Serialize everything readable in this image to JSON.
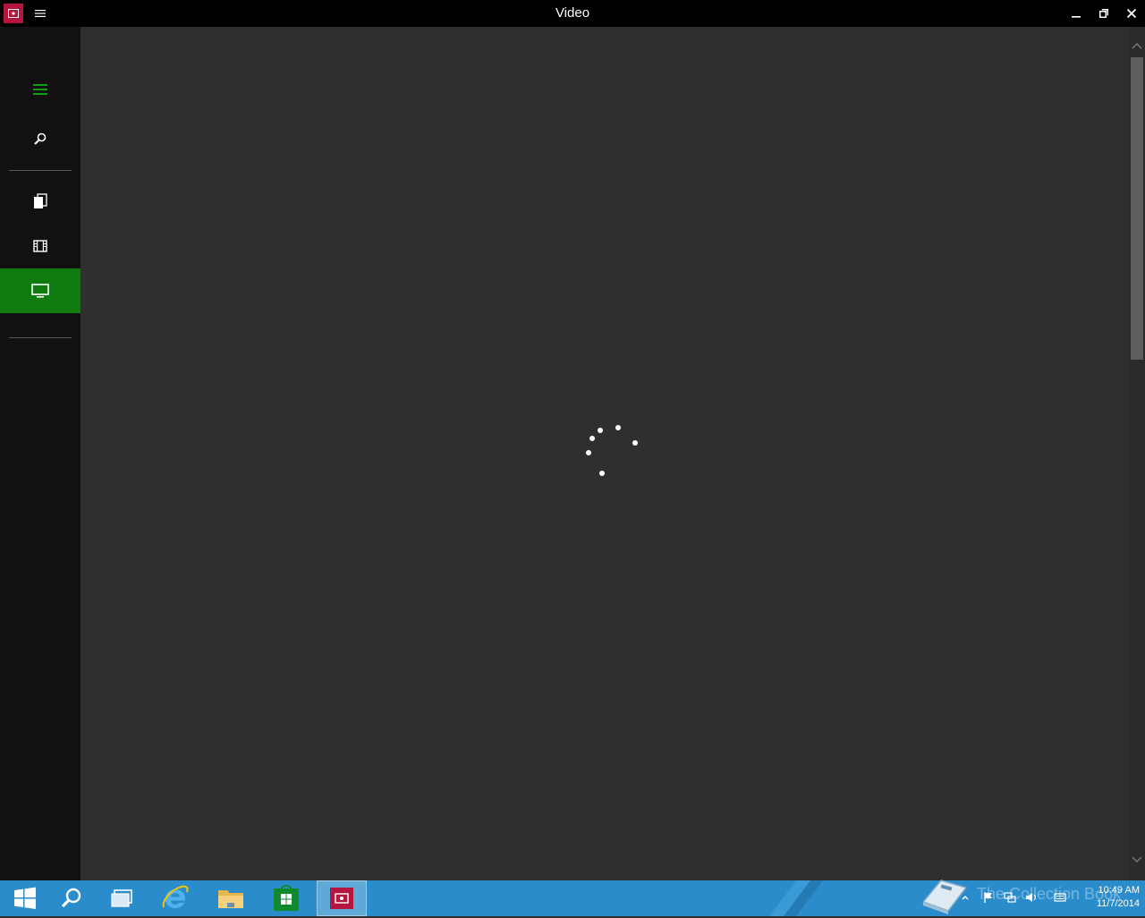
{
  "window": {
    "title": "Video"
  },
  "sidebar": {
    "items": [
      {
        "name": "menu",
        "selected": false
      },
      {
        "name": "search",
        "selected": false
      },
      {
        "name": "collection",
        "selected": false
      },
      {
        "name": "movies",
        "selected": false
      },
      {
        "name": "tv",
        "selected": true
      }
    ]
  },
  "content": {
    "state": "loading"
  },
  "taskbar": {
    "items": [
      "start",
      "search",
      "task-view",
      "internet-explorer",
      "file-explorer",
      "store",
      "video"
    ],
    "watermark": "The Collection Book",
    "clock": {
      "time": "10:49 AM",
      "date": "11/7/2014"
    }
  },
  "colors": {
    "titlebar": "#000000",
    "sidebar": "#111111",
    "content": "#2f2f2f",
    "accent_green": "#107c10",
    "app_icon": "#b5163f",
    "taskbar": "#2b8ccb"
  }
}
